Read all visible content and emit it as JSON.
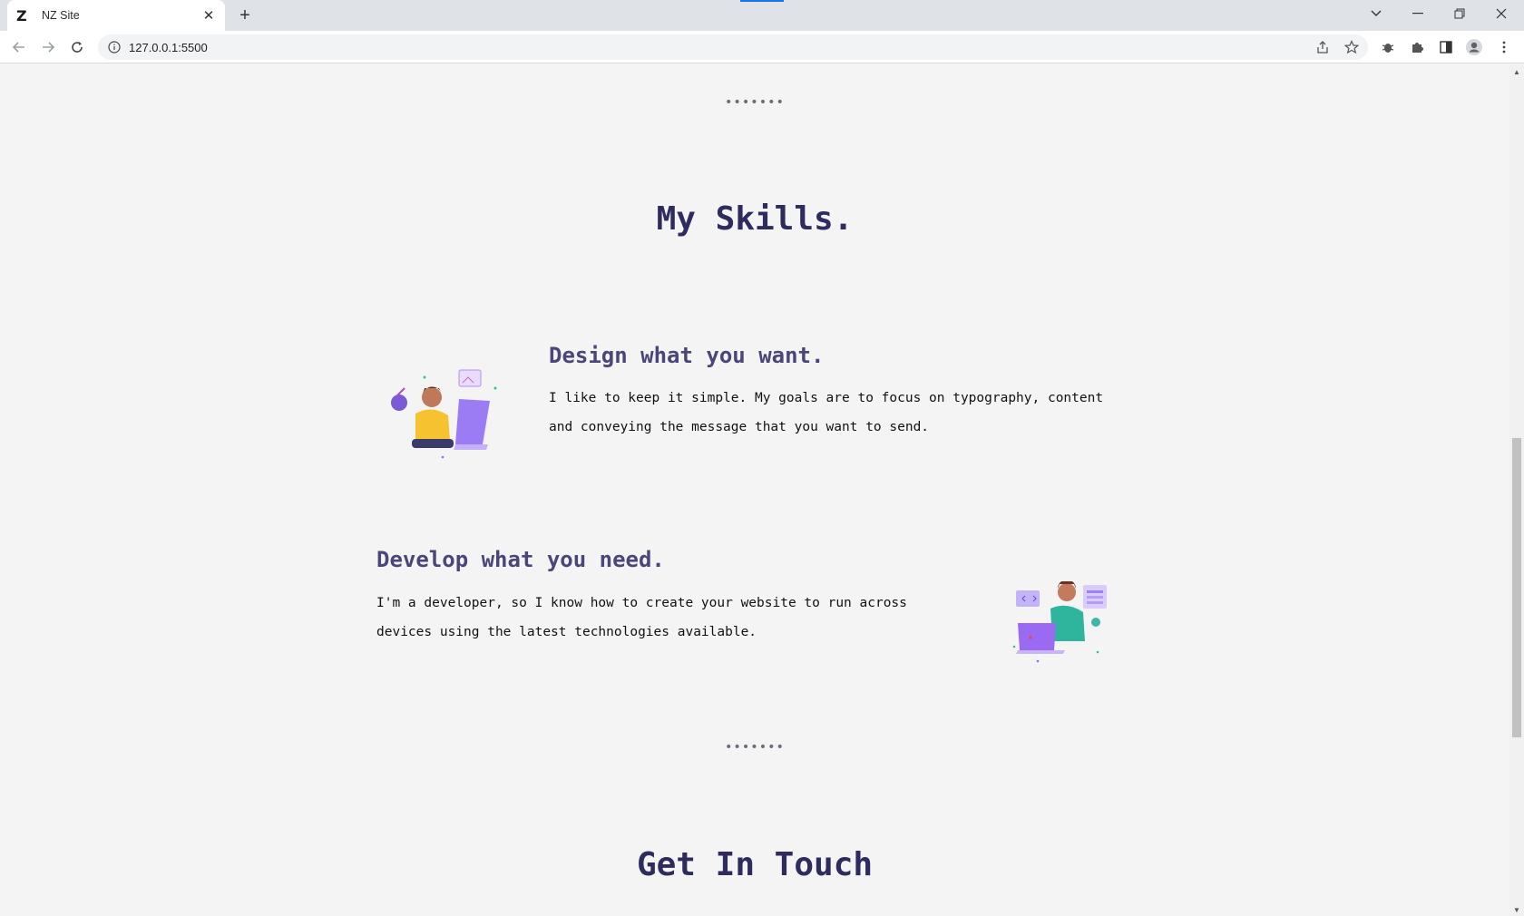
{
  "browser": {
    "tab_title": "NZ Site",
    "tab_favicon": "Z",
    "url": "127.0.0.1:5500"
  },
  "page": {
    "separator_top": "•••••••",
    "skills_heading": "My Skills.",
    "skills": [
      {
        "title": "Design what you want.",
        "text_line1": "I like to keep it simple. My goals are to focus on typography, content",
        "text_line2": "and conveying the message that you want to send."
      },
      {
        "title": "Develop what you need.",
        "text_line1": "I'm a developer, so I know how to create your website to run across",
        "text_line2": "devices using the latest technologies available."
      }
    ],
    "separator_bottom": "•••••••",
    "contact_heading": "Get In Touch"
  },
  "colors": {
    "heading": "#2e2c5e",
    "subheading": "#4a467a",
    "background": "#f4f4f4",
    "accent_purple": "#8b6cf0"
  }
}
